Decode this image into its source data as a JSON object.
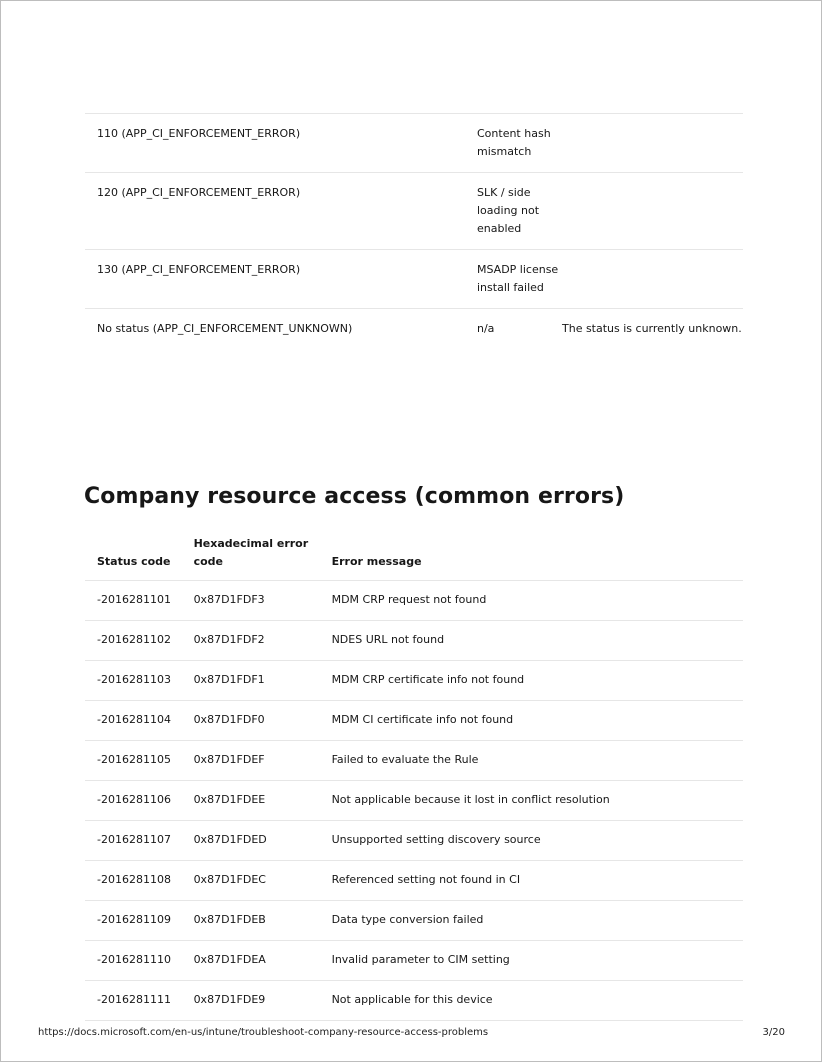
{
  "enforcement_table": {
    "rows": [
      {
        "status": "110 (APP_CI_ENFORCEMENT_ERROR)",
        "meaning": "Content hash mismatch",
        "details": ""
      },
      {
        "status": "120 (APP_CI_ENFORCEMENT_ERROR)",
        "meaning": "SLK / side loading not enabled",
        "details": ""
      },
      {
        "status": "130 (APP_CI_ENFORCEMENT_ERROR)",
        "meaning": "MSADP license install failed",
        "details": ""
      },
      {
        "status": "No status (APP_CI_ENFORCEMENT_UNKNOWN)",
        "meaning": "n/a",
        "details": "The status is currently unknown."
      }
    ]
  },
  "section": {
    "heading": "Company resource access (common errors)"
  },
  "errors_table": {
    "headers": {
      "status_code": "Status code",
      "hex_code": "Hexadecimal error code",
      "message": "Error message"
    },
    "rows": [
      {
        "status": "-2016281101",
        "hex": "0x87D1FDF3",
        "message": "MDM CRP request not found"
      },
      {
        "status": "-2016281102",
        "hex": "0x87D1FDF2",
        "message": "NDES URL not found"
      },
      {
        "status": "-2016281103",
        "hex": "0x87D1FDF1",
        "message": "MDM CRP certificate info not found"
      },
      {
        "status": "-2016281104",
        "hex": "0x87D1FDF0",
        "message": "MDM CI certificate info not found"
      },
      {
        "status": "-2016281105",
        "hex": "0x87D1FDEF",
        "message": "Failed to evaluate the Rule"
      },
      {
        "status": "-2016281106",
        "hex": "0x87D1FDEE",
        "message": "Not applicable because it lost in conflict resolution"
      },
      {
        "status": "-2016281107",
        "hex": "0x87D1FDED",
        "message": "Unsupported setting discovery source"
      },
      {
        "status": "-2016281108",
        "hex": "0x87D1FDEC",
        "message": "Referenced setting not found in CI"
      },
      {
        "status": "-2016281109",
        "hex": "0x87D1FDEB",
        "message": "Data type conversion failed"
      },
      {
        "status": "-2016281110",
        "hex": "0x87D1FDEA",
        "message": "Invalid parameter to CIM setting"
      },
      {
        "status": "-2016281111",
        "hex": "0x87D1FDE9",
        "message": "Not applicable for this device"
      }
    ]
  },
  "footer": {
    "url": "https://docs.microsoft.com/en-us/intune/troubleshoot-company-resource-access-problems",
    "page": "3/20"
  }
}
